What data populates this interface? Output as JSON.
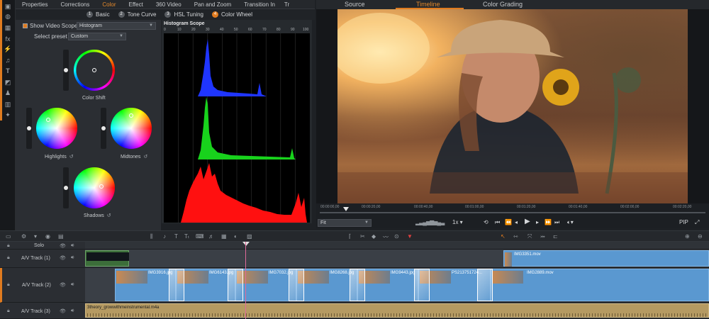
{
  "editor_tabs": [
    "Properties",
    "Corrections",
    "Color",
    "Effect",
    "360 Video",
    "Pan and Zoom",
    "Transition In",
    "Tr"
  ],
  "editor_active_tab": "Color",
  "sub_tabs": [
    {
      "num": "1",
      "label": "Basic"
    },
    {
      "num": "2",
      "label": "Tone Curve"
    },
    {
      "num": "3",
      "label": "HSL Tuning"
    },
    {
      "num": "4",
      "label": "Color Wheel"
    }
  ],
  "sub_active_tab": "Color Wheel",
  "controls": {
    "show_scope_label": "Show Video Scope",
    "show_scope_checked": true,
    "scope_value": "Histogram",
    "preset_label": "Select preset",
    "preset_value": "Custom"
  },
  "wheels": [
    {
      "label": "Color Shift",
      "slider": 0.5
    },
    {
      "label": "Highlights",
      "slider": 0.5
    },
    {
      "label": "Midtones",
      "slider": 0.5
    },
    {
      "label": "Shadows",
      "slider": 0.5
    }
  ],
  "histogram": {
    "title": "Histogram Scope",
    "ticks": [
      "0",
      "10",
      "20",
      "30",
      "40",
      "50",
      "60",
      "70",
      "80",
      "90",
      "100"
    ]
  },
  "preview": {
    "tabs": [
      "Source",
      "Timeline",
      "Color Grading"
    ],
    "active_tab": "Timeline",
    "timecodes": [
      "00:00:00,00",
      "00:00:20,00",
      "00:00:40,00",
      "00:01:00,00",
      "00:01:20,00",
      "00:01:40,00",
      "00:02:00,00",
      "00:02:20,00"
    ],
    "fit_label": "Fit",
    "speed_label": "1x",
    "pip_label": "PIP"
  },
  "tracks": [
    {
      "name": "Solo"
    },
    {
      "name": "A/V Track (1)"
    },
    {
      "name": "A/V Track (2)"
    },
    {
      "name": "A/V Track (3)"
    }
  ],
  "clips": {
    "track1": [
      {
        "name": "IMG3351.mov"
      }
    ],
    "track2": [
      {
        "name": "IMG3916.jpg"
      },
      {
        "name": "IMG6143.jpg"
      },
      {
        "name": "IMG7032.jpg"
      },
      {
        "name": "IMG8268.jpg"
      },
      {
        "name": "IMG9443.jpg"
      },
      {
        "name": "PS213751724..."
      },
      {
        "name": "IMG2889.mov"
      }
    ],
    "track3": [
      {
        "name": "3theory_growwithmeinstrumental.m4a"
      }
    ]
  },
  "colors": {
    "accent": "#e07b1f",
    "clip_blue": "#5a98d0",
    "audio_clip": "#b59a62",
    "playhead": "#e06a9a"
  }
}
